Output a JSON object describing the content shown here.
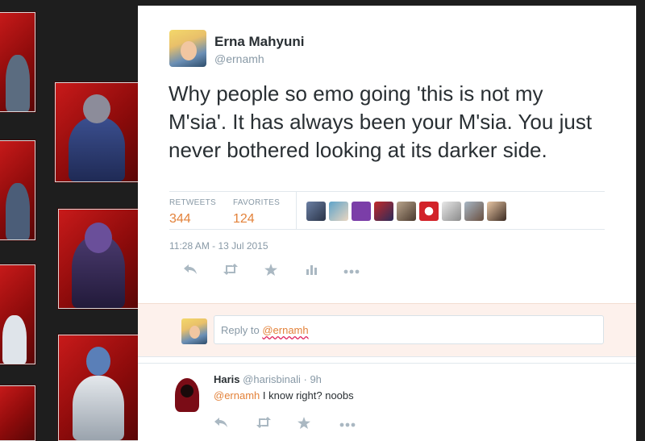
{
  "tweet": {
    "author_name": "Erna Mahyuni",
    "author_handle": "@ernamh",
    "text": "Why people so emo going 'this is not my M'sia'. It has always been your M'sia. You just never bothered looking at its darker side.",
    "retweets_label": "RETWEETS",
    "retweets_count": "344",
    "favorites_label": "FAVORITES",
    "favorites_count": "124",
    "timestamp": "11:28 AM - 13 Jul 2015"
  },
  "actions": [
    "reply-icon",
    "retweet-icon",
    "favorite-icon",
    "analytics-icon",
    "more-icon"
  ],
  "reply_box": {
    "placeholder_prefix": "Reply to",
    "mention": "@ernamh"
  },
  "reply": {
    "name": "Haris",
    "handle": "@harisbinali",
    "age": "· 9h",
    "mention": "@ernamh",
    "text": "I know right? noobs"
  },
  "colors": {
    "accent": "#e3823a",
    "muted": "#8899a6",
    "text": "#292f33",
    "reply_bg": "#fdf1ec"
  }
}
